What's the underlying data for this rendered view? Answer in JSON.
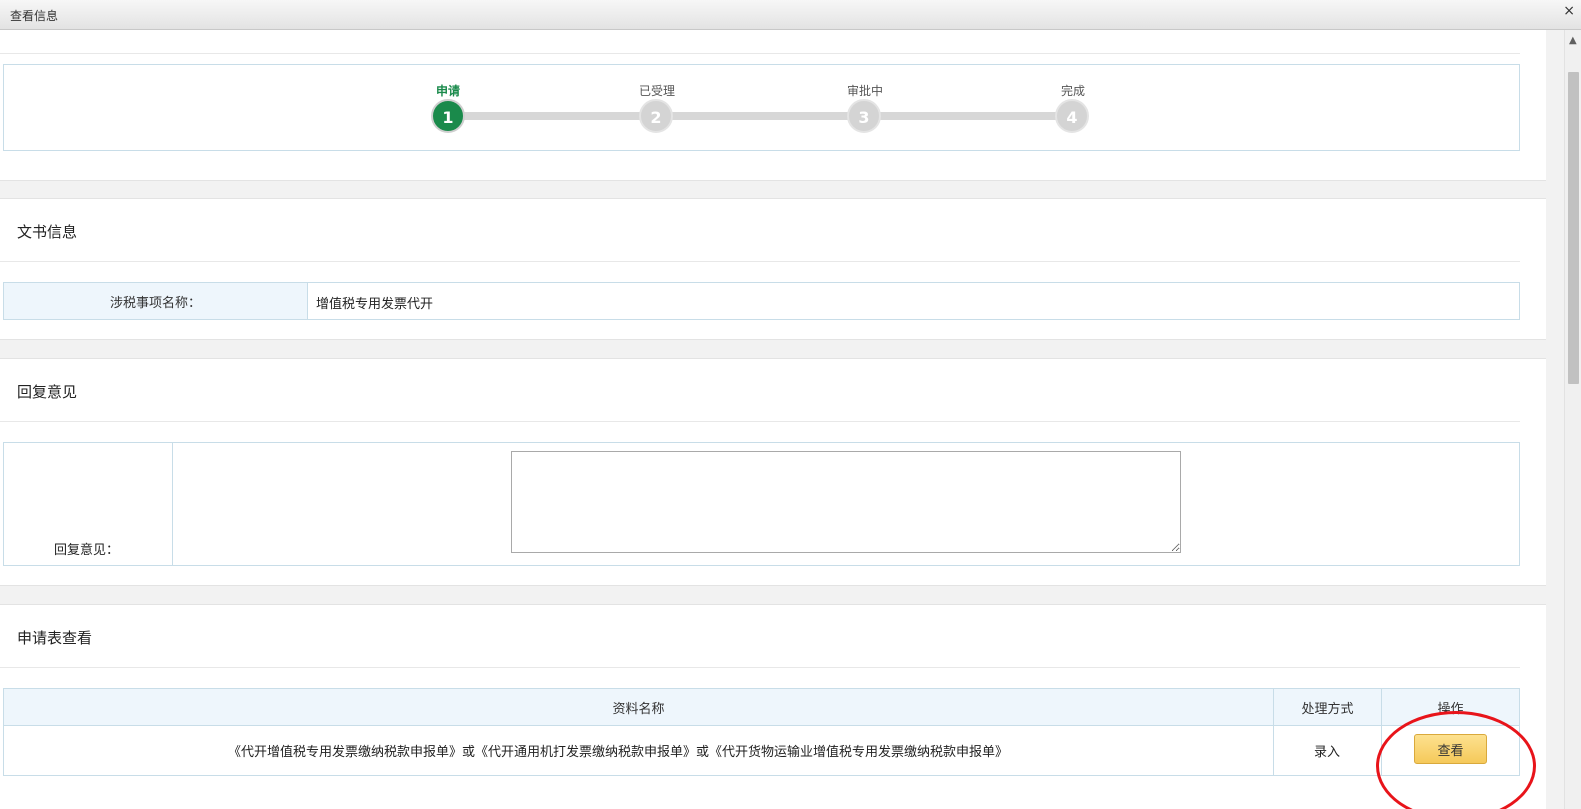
{
  "window": {
    "title": "查看信息",
    "close_glyph": "×"
  },
  "stepper": {
    "steps": [
      {
        "label": "申请",
        "number": "1",
        "state": "active"
      },
      {
        "label": "已受理",
        "number": "2",
        "state": "pending"
      },
      {
        "label": "审批中",
        "number": "3",
        "state": "pending"
      },
      {
        "label": "完成",
        "number": "4",
        "state": "pending"
      }
    ]
  },
  "document_info": {
    "title": "文书信息",
    "field_label": "涉税事项名称：",
    "field_value": "增值税专用发票代开"
  },
  "reply": {
    "title": "回复意见",
    "field_label": "回复意见：",
    "textarea_value": ""
  },
  "application": {
    "title": "申请表查看",
    "columns": [
      "资料名称",
      "处理方式",
      "操作"
    ],
    "rows": [
      {
        "name": "《代开增值税专用发票缴纳税款申报单》或《代开通用机打发票缴纳税款申报单》或《代开货物运输业增值税专用发票缴纳税款申报单》",
        "method": "录入",
        "action_label": "查看"
      }
    ]
  },
  "colors": {
    "active_step": "#1a8a4b",
    "pending_step": "#d4d4d4",
    "header_bg": "#eef6fc",
    "button_bg": "#f5c95a",
    "highlight": "#e8141a"
  }
}
